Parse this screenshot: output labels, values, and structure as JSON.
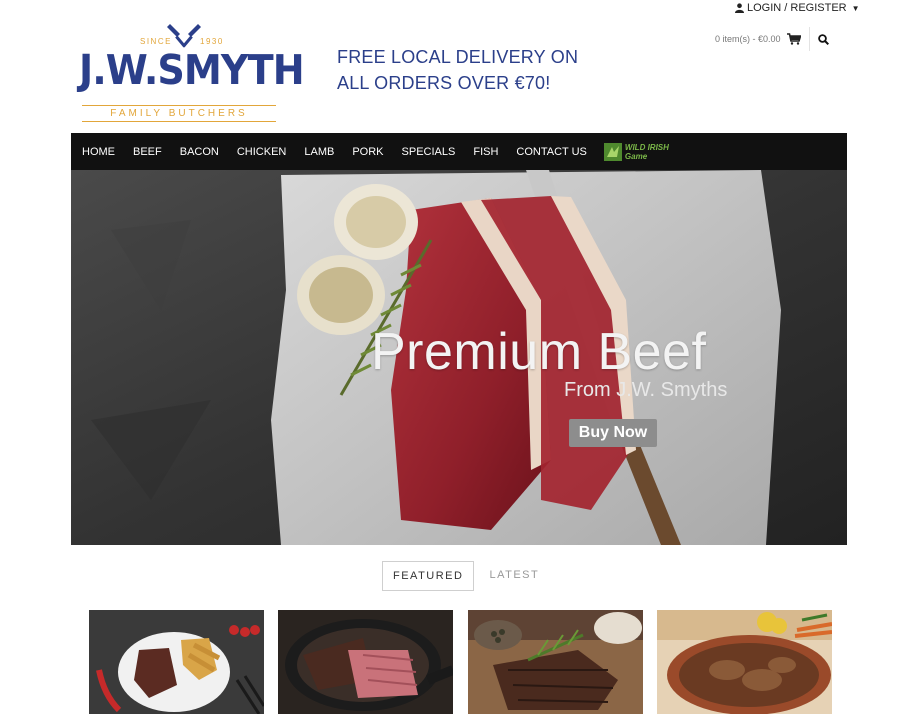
{
  "topbar": {
    "login_label": "LOGIN / REGISTER",
    "cart_summary": "0 item(s) - €0.00"
  },
  "logo": {
    "since": "SINCE",
    "year": "1930",
    "name": "J.W.SMYTH",
    "tagline": "FAMILY BUTCHERS"
  },
  "promo": {
    "text": "FREE LOCAL DELIVERY ON ALL ORDERS OVER €70!"
  },
  "nav": {
    "items": [
      "HOME",
      "BEEF",
      "BACON",
      "CHICKEN",
      "LAMB",
      "PORK",
      "SPECIALS",
      "FISH",
      "CONTACT US"
    ],
    "wild_logo": {
      "top": "WILD IRISH",
      "bottom": "Game"
    }
  },
  "hero": {
    "headline": "Premium Beef",
    "subline": "From J.W. Smyths",
    "cta": "Buy Now"
  },
  "tabs": [
    {
      "label": "FEATURED",
      "active": true
    },
    {
      "label": "LATEST",
      "active": false
    }
  ],
  "products": [
    {
      "icon": "steak-with-chips-image"
    },
    {
      "icon": "roast-beef-pan-image"
    },
    {
      "icon": "grilled-steak-rosemary-image"
    },
    {
      "icon": "stew-dish-image"
    }
  ],
  "colors": {
    "brand_blue": "#2b3f8a",
    "brand_gold": "#e2a63a",
    "nav_bg": "#111111",
    "button_gray": "#8d8d8d"
  }
}
